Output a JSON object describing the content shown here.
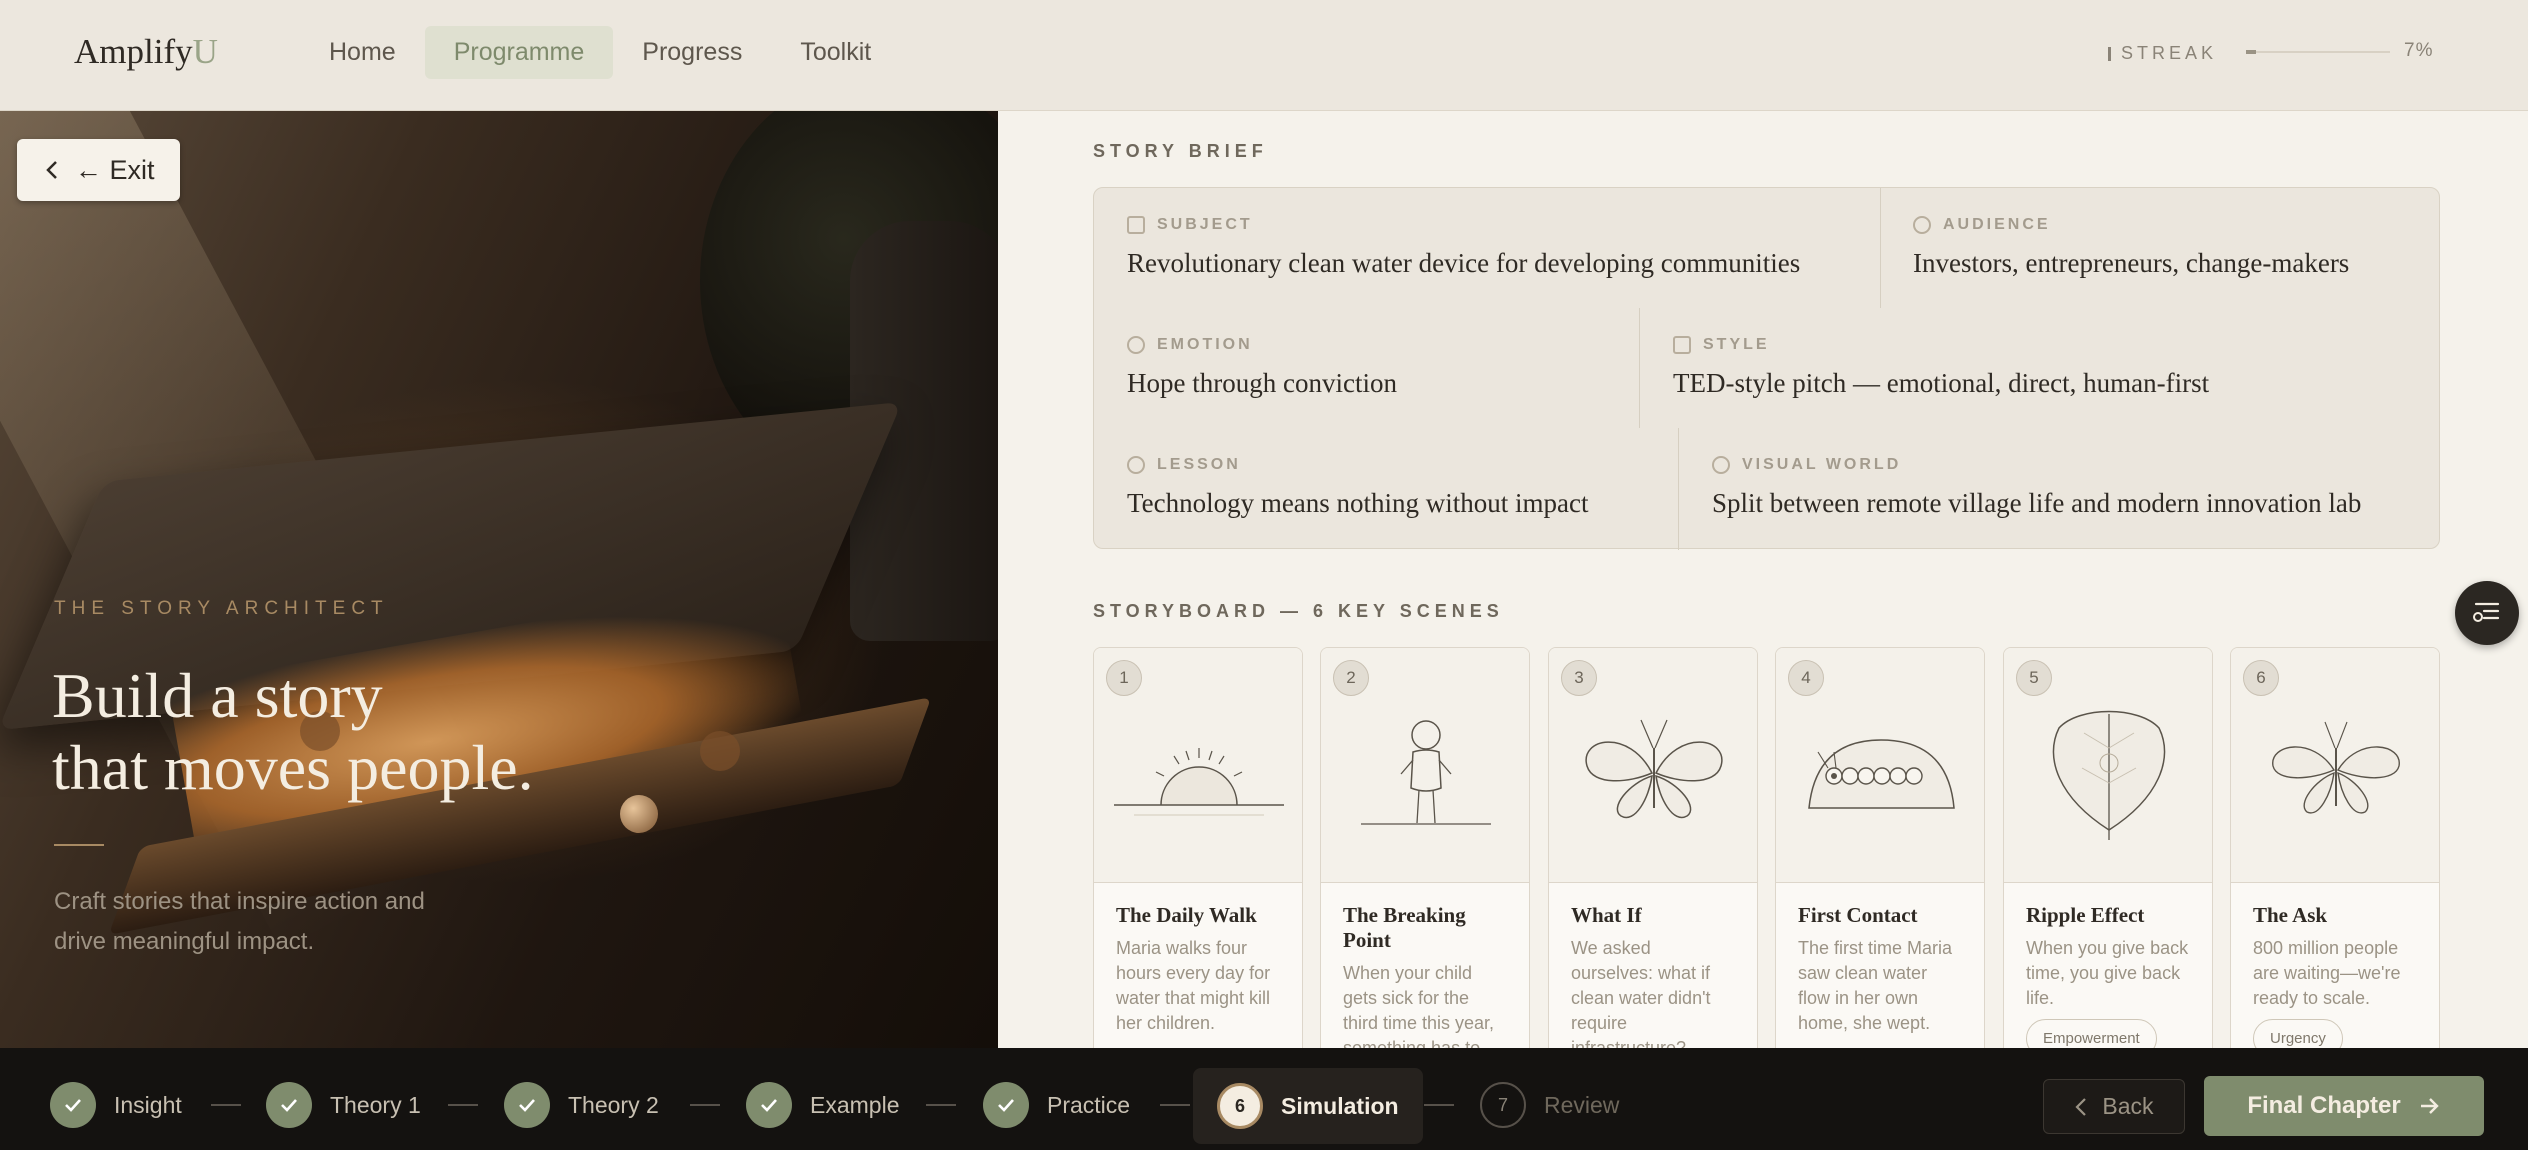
{
  "app": {
    "logo_main": "Amplify",
    "logo_accent": "U"
  },
  "nav": {
    "items": [
      {
        "label": "Home"
      },
      {
        "label": "Programme",
        "active": true
      },
      {
        "label": "Progress"
      },
      {
        "label": "Toolkit"
      }
    ]
  },
  "streak": {
    "label": "STREAK",
    "progress_percent": 7,
    "progress_label": "7%"
  },
  "hero": {
    "exit_label": "← Exit",
    "eyebrow": "THE STORY ARCHITECT",
    "headline_line1": "Build a story",
    "headline_line2": "that moves people.",
    "subtext": "Craft stories that inspire action and drive meaningful impact."
  },
  "brief": {
    "section_label": "STORY BRIEF",
    "subject": {
      "label": "SUBJECT",
      "value": "Revolutionary clean water device for developing communities"
    },
    "audience": {
      "label": "AUDIENCE",
      "value": "Investors, entrepreneurs, change-makers"
    },
    "emotion": {
      "label": "EMOTION",
      "value": "Hope through conviction"
    },
    "style": {
      "label": "STYLE",
      "value": "TED-style pitch — emotional, direct, human-first"
    },
    "lesson": {
      "label": "LESSON",
      "value": "Technology means nothing without impact"
    },
    "visual_world": {
      "label": "VISUAL WORLD",
      "value": "Split between remote village life and modern innovation lab"
    }
  },
  "storyboard": {
    "section_label": "STORYBOARD — 6 KEY SCENES",
    "scenes": [
      {
        "num": "1",
        "title": "The Daily Walk",
        "desc": "Maria walks four hours every day for water that might kill her children.",
        "icon": "sunrise-icon"
      },
      {
        "num": "2",
        "title": "The Breaking Point",
        "desc": "When your child gets sick for the third time this year, something has to change.",
        "icon": "person-icon"
      },
      {
        "num": "3",
        "title": "What If",
        "desc": "We asked ourselves: what if clean water didn't require infrastructure?",
        "icon": "butterfly-icon"
      },
      {
        "num": "4",
        "title": "First Contact",
        "desc": "The first time Maria saw clean water flow in her own home, she wept.",
        "icon": "caterpillar-icon"
      },
      {
        "num": "5",
        "title": "Ripple Effect",
        "desc": "When you give back time, you give back life.",
        "tag": "Empowerment",
        "icon": "leaf-icon"
      },
      {
        "num": "6",
        "title": "The Ask",
        "desc": "800 million people are waiting—we're ready to scale.",
        "tag": "Urgency",
        "icon": "butterfly-icon"
      }
    ]
  },
  "steps": [
    {
      "label": "Insight",
      "state": "done"
    },
    {
      "label": "Theory 1",
      "state": "done"
    },
    {
      "label": "Theory 2",
      "state": "done"
    },
    {
      "label": "Example",
      "state": "done"
    },
    {
      "label": "Practice",
      "state": "done"
    },
    {
      "label": "Simulation",
      "num": "6",
      "state": "current"
    },
    {
      "label": "Review",
      "num": "7",
      "state": "future"
    }
  ],
  "footer": {
    "back_label": "Back",
    "final_label": "Final Chapter"
  }
}
